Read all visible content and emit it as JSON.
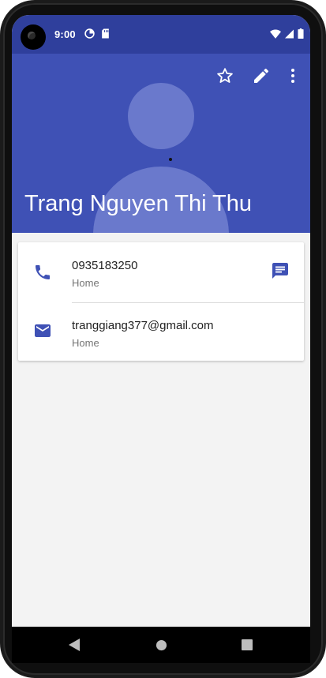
{
  "status_bar": {
    "time": "9:00",
    "left_icons": [
      "data-saver-icon",
      "sd-card-icon"
    ],
    "right_icons": [
      "wifi-icon",
      "cell-signal-icon",
      "battery-icon"
    ]
  },
  "header": {
    "contact_name": "Trang Nguyen Thi Thu",
    "actions": [
      "star-outline-icon",
      "edit-pencil-icon",
      "more-vert-icon"
    ],
    "avatar": "default-person-avatar"
  },
  "details": [
    {
      "icon": "phone-icon",
      "value": "0935183250",
      "label": "Home",
      "action_icon": "message-icon"
    },
    {
      "icon": "email-icon",
      "value": "tranggiang377@gmail.com",
      "label": "Home"
    }
  ],
  "nav_bar": {
    "buttons": [
      "back-icon",
      "home-icon",
      "recents-icon"
    ]
  },
  "colors": {
    "primary": "#3f51b5",
    "primary_dark": "#2f3f9c",
    "avatar_tint": "#6a79cc",
    "background": "#f3f3f3"
  }
}
